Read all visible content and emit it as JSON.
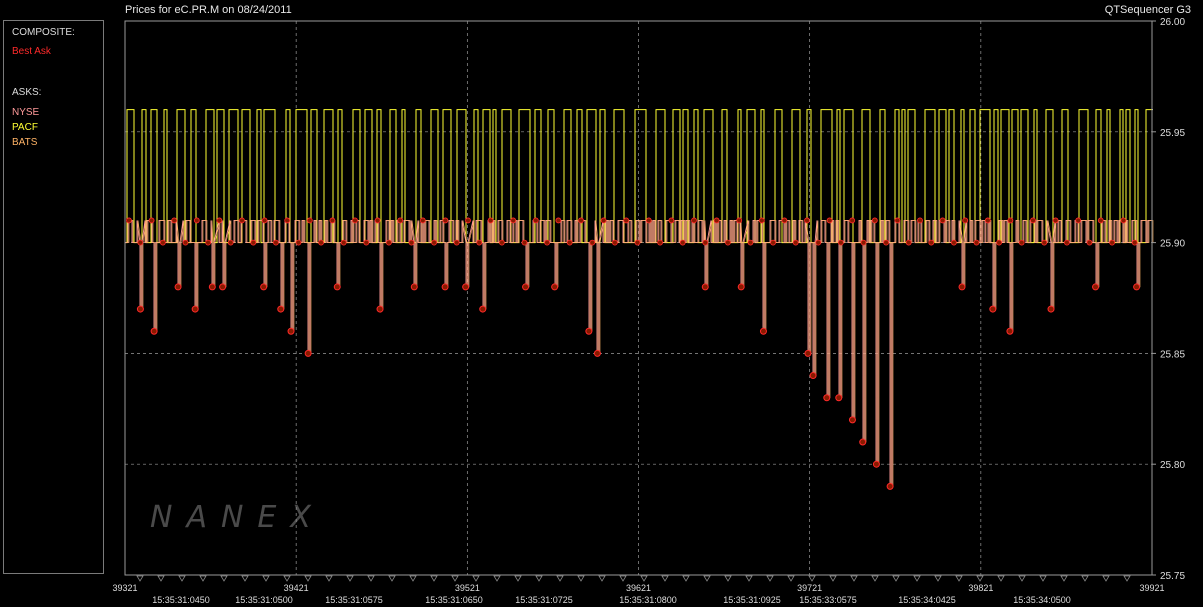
{
  "header": {
    "title": "Prices for  eC.PR.M  on  08/24/2011",
    "brand": "QTSequencer G3"
  },
  "legend": {
    "composite_heading": "COMPOSITE:",
    "composite_item": "Best Ask",
    "asks_heading": "ASKS:",
    "asks_items": [
      "NYSE",
      "PACF",
      "BATS"
    ]
  },
  "watermark": "NANEX",
  "colors": {
    "best_ask": "#ff2a2a",
    "nyse": "#ff9a9a",
    "pacf": "#ffff33",
    "bats": "#ffb366",
    "grid": "#9a9a9a",
    "frame": "#9a9a9a"
  },
  "chart_data": {
    "type": "line",
    "ylim": [
      25.75,
      26.0
    ],
    "y_ticks": [
      "26.00",
      "25.95",
      "25.90",
      "25.85",
      "25.80",
      "25.75"
    ],
    "x_sequence_labels": [
      "39321",
      "39421",
      "39521",
      "39621",
      "39721",
      "39821",
      "39921"
    ],
    "x_time_labels": [
      "15:35:31:0450",
      "15:35:31:0500",
      "15:35:31:0575",
      "15:35:31:0650",
      "15:35:31:0725",
      "15:35:31:0800",
      "15:35:31:0925",
      "15:35:33:0575",
      "15:35:34:0425",
      "15:35:34:0500"
    ],
    "x_range": [
      39321,
      39921
    ],
    "series": [
      {
        "name": "PACF",
        "description": "step line oscillating between 25.96 and 25.90",
        "high": 25.96,
        "low": 25.9
      },
      {
        "name": "Best Ask",
        "description": "mostly 25.90-25.91 with dips to lower levels",
        "baseline": 25.9,
        "dips": [
          {
            "x": 39330,
            "y": 25.87
          },
          {
            "x": 39338,
            "y": 25.86
          },
          {
            "x": 39352,
            "y": 25.88
          },
          {
            "x": 39362,
            "y": 25.87
          },
          {
            "x": 39372,
            "y": 25.88
          },
          {
            "x": 39378,
            "y": 25.88
          },
          {
            "x": 39402,
            "y": 25.88
          },
          {
            "x": 39412,
            "y": 25.87
          },
          {
            "x": 39418,
            "y": 25.86
          },
          {
            "x": 39428,
            "y": 25.85
          },
          {
            "x": 39445,
            "y": 25.88
          },
          {
            "x": 39470,
            "y": 25.87
          },
          {
            "x": 39490,
            "y": 25.88
          },
          {
            "x": 39508,
            "y": 25.88
          },
          {
            "x": 39520,
            "y": 25.88
          },
          {
            "x": 39530,
            "y": 25.87
          },
          {
            "x": 39555,
            "y": 25.88
          },
          {
            "x": 39572,
            "y": 25.88
          },
          {
            "x": 39592,
            "y": 25.86
          },
          {
            "x": 39597,
            "y": 25.85
          },
          {
            "x": 39660,
            "y": 25.88
          },
          {
            "x": 39681,
            "y": 25.88
          },
          {
            "x": 39694,
            "y": 25.86
          },
          {
            "x": 39720,
            "y": 25.85
          },
          {
            "x": 39723,
            "y": 25.84
          },
          {
            "x": 39731,
            "y": 25.83
          },
          {
            "x": 39738,
            "y": 25.83
          },
          {
            "x": 39746,
            "y": 25.82
          },
          {
            "x": 39752,
            "y": 25.81
          },
          {
            "x": 39760,
            "y": 25.8
          },
          {
            "x": 39768,
            "y": 25.79
          },
          {
            "x": 39810,
            "y": 25.88
          },
          {
            "x": 39828,
            "y": 25.87
          },
          {
            "x": 39838,
            "y": 25.86
          },
          {
            "x": 39862,
            "y": 25.87
          },
          {
            "x": 39888,
            "y": 25.88
          },
          {
            "x": 39912,
            "y": 25.88
          }
        ]
      }
    ],
    "grid": true
  }
}
